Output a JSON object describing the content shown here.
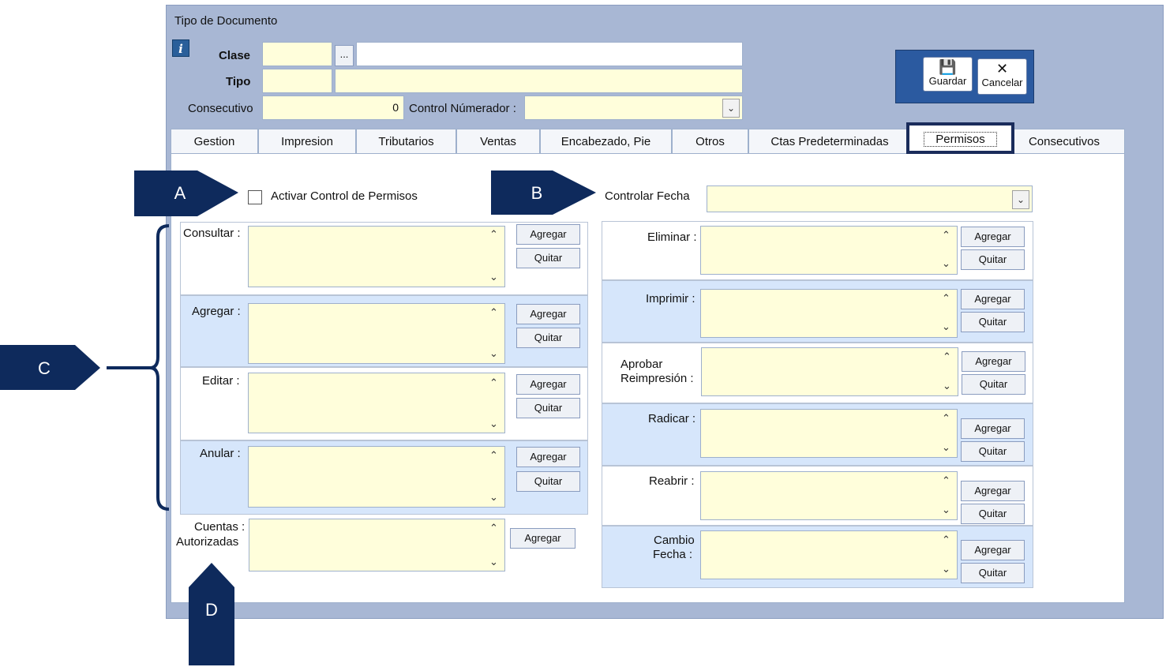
{
  "window": {
    "title": "Tipo de Documento"
  },
  "header": {
    "clase_label": "Clase",
    "tipo_label": "Tipo",
    "consecutivo_label": "Consecutivo",
    "consecutivo_value": "0",
    "control_numerador_label": "Control Númerador :",
    "ellipsis": "..."
  },
  "toolbar": {
    "guardar": "Guardar",
    "cancelar": "Cancelar"
  },
  "tabs": [
    "Gestion",
    "Impresion",
    "Tributarios",
    "Ventas",
    "Encabezado, Pie",
    "Otros",
    "Ctas Predeterminadas",
    "Permisos",
    "Consecutivos"
  ],
  "permisos": {
    "activar_label": "Activar Control de Permisos",
    "controlar_fecha_label": "Controlar Fecha",
    "left": {
      "consultar": "Consultar :",
      "agregar": "Agregar :",
      "editar": "Editar :",
      "anular": "Anular :",
      "cuentas_1": "Cuentas :",
      "cuentas_2": "Autorizadas"
    },
    "right": {
      "eliminar": "Eliminar :",
      "imprimir": "Imprimir :",
      "aprobar_1": "Aprobar",
      "aprobar_2": "Reimpresión :",
      "radicar": "Radicar :",
      "reabrir": "Reabrir :",
      "cambio_1": "Cambio",
      "cambio_2": "Fecha :"
    },
    "btn_agregar": "Agregar",
    "btn_quitar": "Quitar"
  },
  "callouts": {
    "a": "A",
    "b": "B",
    "c": "C",
    "d": "D"
  },
  "icons": {
    "info": "info-icon",
    "save": "floppy-disk-icon",
    "cancel": "scissors-icon"
  },
  "colors": {
    "field": "#fffedb",
    "window": "#a8b7d4",
    "callout": "#0e2a5c",
    "alt_row": "#d6e6fb"
  }
}
